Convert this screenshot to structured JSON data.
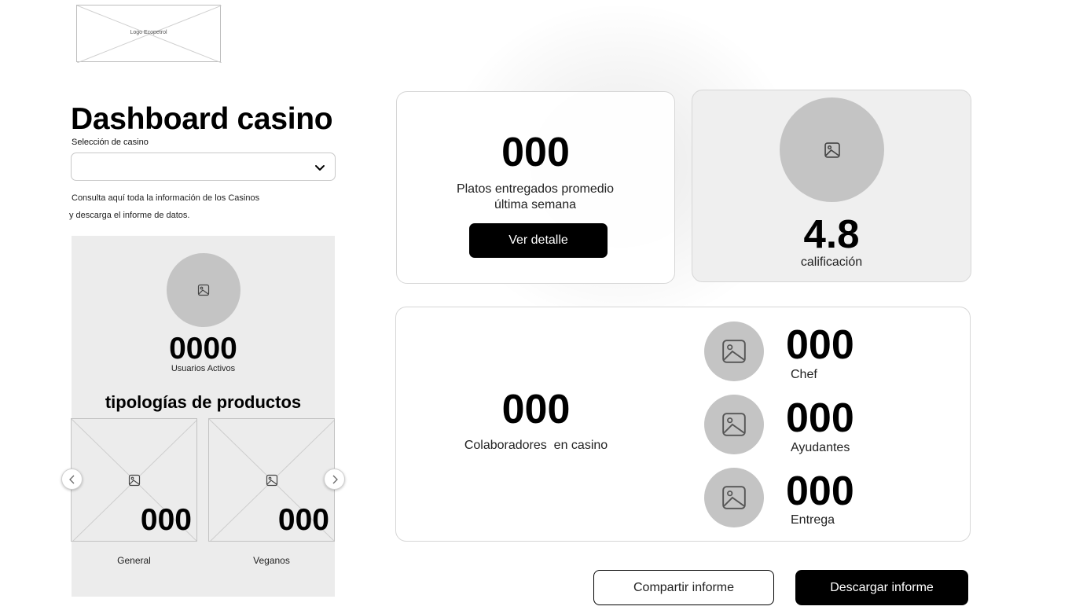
{
  "logo": {
    "text": "Logo Ecopetrol"
  },
  "header": {
    "title": "Dashboard casino",
    "select_label": "Selección de casino",
    "select_value": "",
    "description_line1": "Consulta aquí toda la información de los Casinos",
    "description_line2": "y descarga el informe de datos."
  },
  "sidebar": {
    "users_count": "0000",
    "users_label": "Usuarios Activos",
    "section_title": "tipologías de productos",
    "products": [
      {
        "value": "000",
        "label": "General"
      },
      {
        "value": "000",
        "label": "Veganos"
      }
    ]
  },
  "cards": {
    "platos": {
      "value": "000",
      "label": "Platos entregados promedio última semana",
      "button": "Ver detalle"
    },
    "rating": {
      "value": "4.8",
      "label": "calificación"
    },
    "colaboradores": {
      "value": "000",
      "label": "Colaboradores  en casino",
      "roles": [
        {
          "value": "000",
          "label": "Chef"
        },
        {
          "value": "000",
          "label": "Ayudantes"
        },
        {
          "value": "000",
          "label": "Entrega"
        }
      ]
    }
  },
  "actions": {
    "share": "Compartir informe",
    "download": "Descargar informe"
  },
  "icons": {
    "chevron": "chevron-down-icon",
    "image": "image-placeholder-icon",
    "prev": "chevron-left-icon",
    "next": "chevron-right-icon"
  }
}
